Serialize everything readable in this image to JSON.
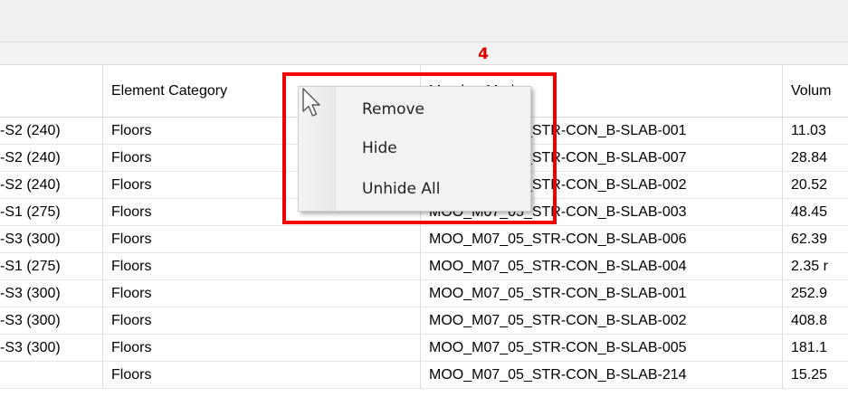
{
  "step_number": "4",
  "columns": {
    "col0": "",
    "element_category": "Element Category",
    "member_mark": "Member Mark",
    "volume": "Volum"
  },
  "rows": [
    {
      "c0": "-S2 (240)",
      "c1": "Floors",
      "c2": "MOO_M07_05_STR-CON_B-SLAB-001",
      "c3": "11.03"
    },
    {
      "c0": "-S2 (240)",
      "c1": "Floors",
      "c2": "MOO_M07_05_STR-CON_B-SLAB-007",
      "c3": "28.84"
    },
    {
      "c0": "-S2 (240)",
      "c1": "Floors",
      "c2": "MOO_M07_05_STR-CON_B-SLAB-002",
      "c3": "20.52"
    },
    {
      "c0": "-S1 (275)",
      "c1": "Floors",
      "c2": "MOO_M07_05_STR-CON_B-SLAB-003",
      "c3": "48.45"
    },
    {
      "c0": "-S3 (300)",
      "c1": "Floors",
      "c2": "MOO_M07_05_STR-CON_B-SLAB-006",
      "c3": "62.39"
    },
    {
      "c0": "-S1 (275)",
      "c1": "Floors",
      "c2": "MOO_M07_05_STR-CON_B-SLAB-004",
      "c3": "2.35 r"
    },
    {
      "c0": "-S3 (300)",
      "c1": "Floors",
      "c2": "MOO_M07_05_STR-CON_B-SLAB-001",
      "c3": "252.9"
    },
    {
      "c0": "-S3 (300)",
      "c1": "Floors",
      "c2": "MOO_M07_05_STR-CON_B-SLAB-002",
      "c3": "408.8"
    },
    {
      "c0": "-S3 (300)",
      "c1": "Floors",
      "c2": "MOO_M07_05_STR-CON_B-SLAB-005",
      "c3": "181.1"
    },
    {
      "c0": "",
      "c1": "Floors",
      "c2": "MOO_M07_05_STR-CON_B-SLAB-214",
      "c3": "15.25"
    }
  ],
  "context_menu": {
    "remove": "Remove",
    "hide": "Hide",
    "unhide_all": "Unhide All"
  },
  "colors": {
    "highlight": "#f20000",
    "step_label": "#e00000"
  },
  "icons": {
    "cursor": "mouse-pointer-icon"
  }
}
